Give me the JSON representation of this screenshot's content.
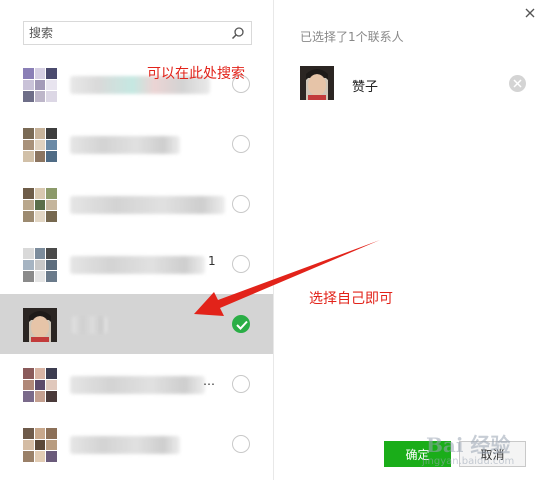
{
  "search": {
    "placeholder": "搜索"
  },
  "annotations": {
    "search_hint": "可以在此处搜索",
    "select_hint": "选择自己即可"
  },
  "contacts": [
    {
      "name_suffix": "",
      "checked": false
    },
    {
      "name_suffix": "",
      "checked": false
    },
    {
      "name_suffix": "",
      "checked": false
    },
    {
      "name_suffix": "1",
      "checked": false
    },
    {
      "name_suffix": "",
      "checked": true
    },
    {
      "name_suffix": "…",
      "checked": false
    },
    {
      "name_suffix": "",
      "checked": false
    }
  ],
  "selected_panel": {
    "title": "已选择了1个联系人",
    "selected_contact_name": "赞子"
  },
  "buttons": {
    "confirm": "确定",
    "cancel": "取消"
  },
  "watermark": {
    "brand": "Bai 经验",
    "url": "jingyan.baidu.com"
  },
  "colors": {
    "accent_green": "#1aad19",
    "annotation_red": "#e2231a",
    "selected_row": "#d4d4d4"
  }
}
